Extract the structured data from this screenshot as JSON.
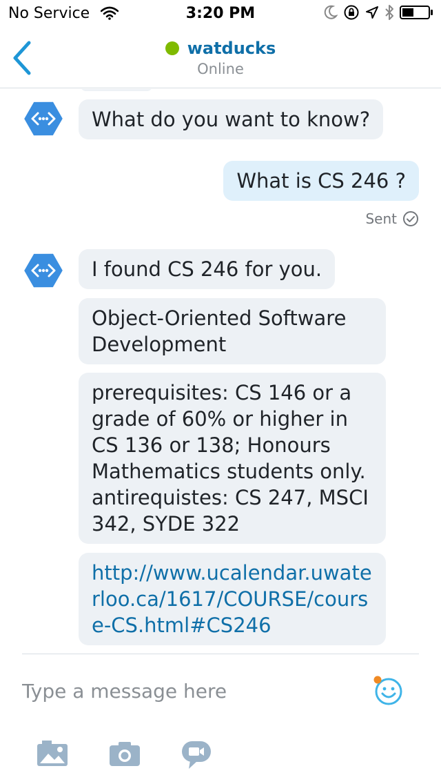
{
  "status_bar": {
    "carrier": "No Service",
    "time": "3:20 PM",
    "icons": [
      "wifi-icon",
      "moon-icon",
      "orientation-lock-icon",
      "location-arrow-icon",
      "bluetooth-icon",
      "battery-icon"
    ]
  },
  "header": {
    "back_icon": "chevron-left-icon",
    "contact_name": "watducks",
    "contact_status": "Online",
    "presence_color": "#7fba00"
  },
  "messages": [
    {
      "sender": "bot",
      "text": "What do you want to know?"
    },
    {
      "sender": "user",
      "text": "What is CS 246 ?",
      "receipt": "Sent"
    },
    {
      "sender": "bot",
      "text": "I found CS 246 for you."
    },
    {
      "sender": "bot",
      "text": "Object-Oriented Software Development"
    },
    {
      "sender": "bot",
      "text": "prerequisites: CS 146 or a grade of 60% or higher in CS 136 or 138; Honours Mathematics students only. antirequistes: CS 247, MSCI 342, SYDE 322"
    },
    {
      "sender": "bot",
      "text": "http://www.ucalendar.uwaterloo.ca/1617/COURSE/course-CS.html#CS246"
    }
  ],
  "composer": {
    "placeholder": "Type a message here",
    "emoji_icon": "smiley-icon",
    "tools": [
      "photo-gallery-icon",
      "camera-icon",
      "video-message-icon"
    ]
  },
  "colors": {
    "accent": "#0f6fa8",
    "bot_bubble": "#edf1f5",
    "user_bubble": "#dff0fb",
    "bot_avatar": "#3a8ee0",
    "emoji": "#3fb4e8",
    "notification_dot": "#f08a24"
  }
}
